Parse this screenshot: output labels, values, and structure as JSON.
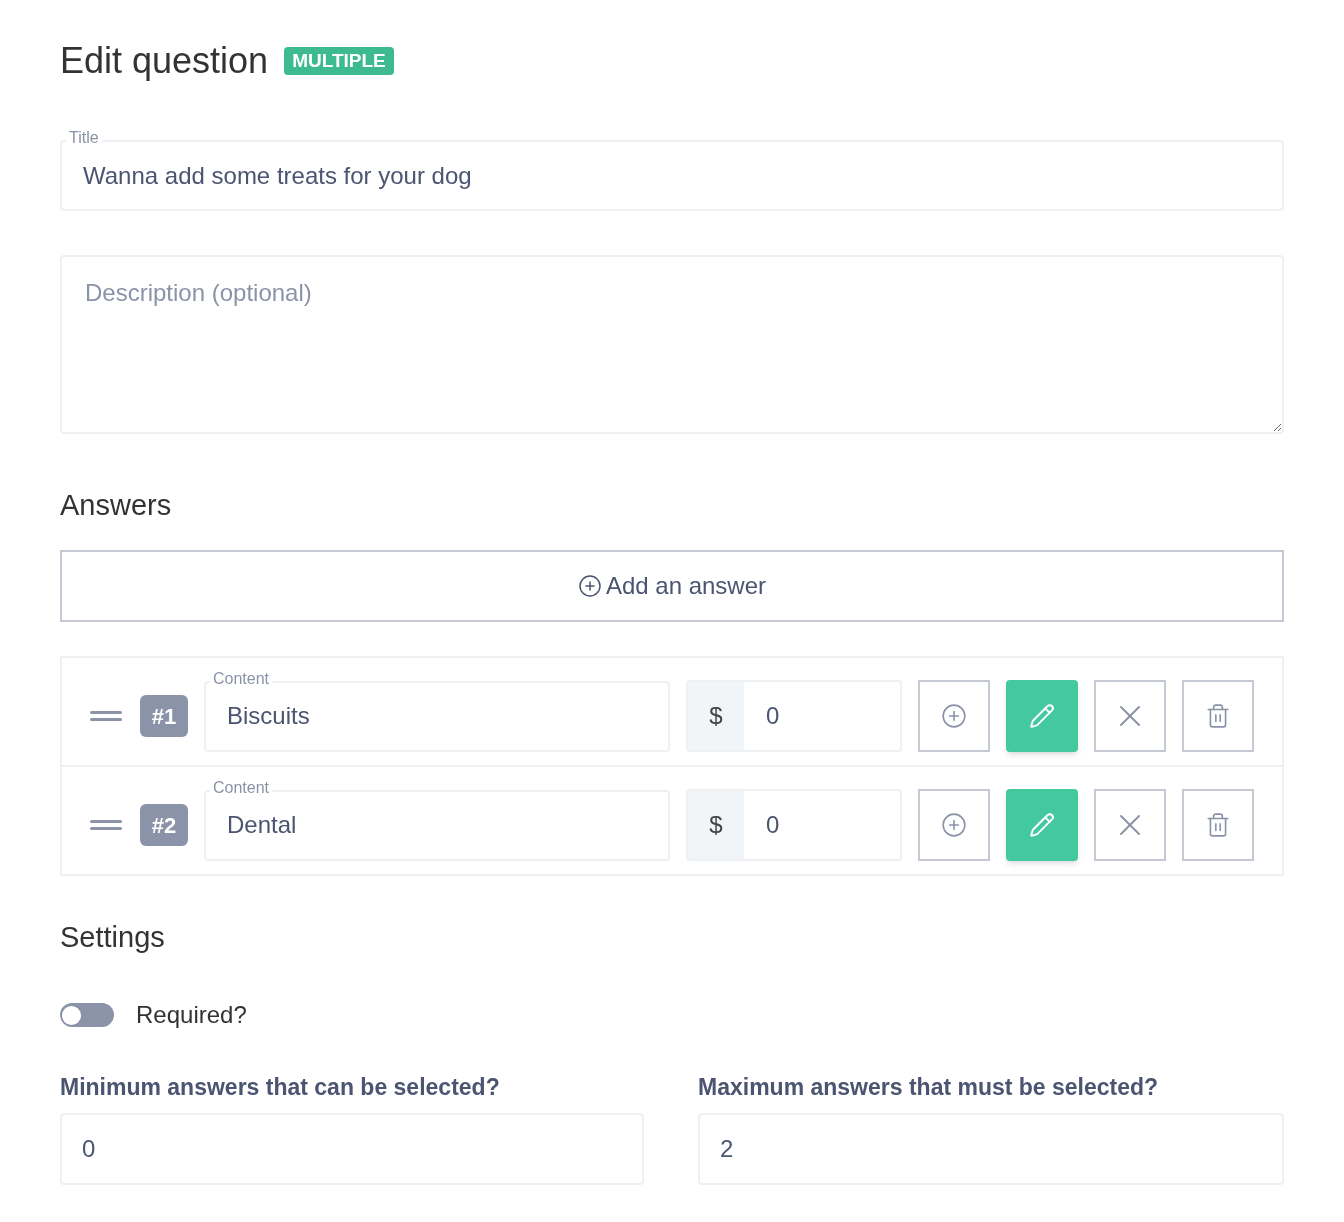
{
  "heading": {
    "title": "Edit question",
    "badge": "MULTIPLE"
  },
  "title_field": {
    "label": "Title",
    "value": "Wanna add some treats for your dog"
  },
  "description_field": {
    "placeholder": "Description (optional)"
  },
  "answers": {
    "heading": "Answers",
    "add_button": "Add an answer",
    "items": [
      {
        "number": "#1",
        "label": "Content",
        "value": "Biscuits",
        "currency": "$",
        "price": "0"
      },
      {
        "number": "#2",
        "label": "Content",
        "value": "Dental",
        "currency": "$",
        "price": "0"
      }
    ]
  },
  "settings": {
    "heading": "Settings",
    "required": {
      "label": "Required?",
      "on": false
    },
    "min": {
      "label": "Minimum answers that can be selected?",
      "value": "0"
    },
    "max": {
      "label": "Maximum answers that must be selected?",
      "value": "2"
    }
  }
}
